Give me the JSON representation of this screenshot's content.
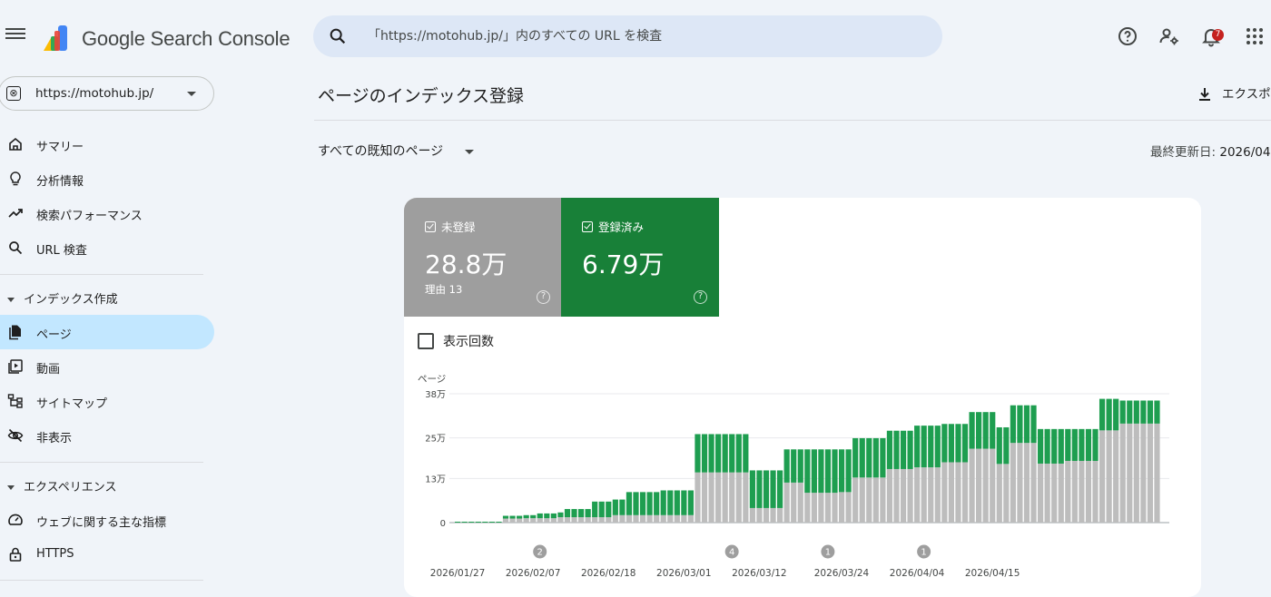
{
  "header": {
    "brand": "Google Search Console",
    "search_placeholder": "「https://motohub.jp/」内のすべての URL を検査",
    "notification_count": "7",
    "icons": [
      "menu-icon",
      "search-icon",
      "help-icon",
      "account-settings-icon",
      "bell-icon",
      "apps-icon"
    ]
  },
  "sidebar": {
    "property": "https://motohub.jp/",
    "items": [
      {
        "label": "サマリー",
        "icon": "home-icon"
      },
      {
        "label": "分析情報",
        "icon": "lightbulb-icon"
      },
      {
        "label": "検索パフォーマンス",
        "icon": "trending-icon"
      },
      {
        "label": "URL 検査",
        "icon": "search-icon"
      }
    ],
    "section_index": "インデックス作成",
    "index_items": [
      {
        "label": "ページ",
        "icon": "pages-icon",
        "active": true
      },
      {
        "label": "動画",
        "icon": "video-icon"
      },
      {
        "label": "サイトマップ",
        "icon": "sitemap-icon"
      },
      {
        "label": "非表示",
        "icon": "hidden-icon"
      }
    ],
    "section_experience": "エクスペリエンス",
    "experience_items": [
      {
        "label": "ウェブに関する主な指標",
        "icon": "gauge-icon"
      },
      {
        "label": "HTTPS",
        "icon": "lock-icon"
      }
    ]
  },
  "main": {
    "title": "ページのインデックス登録",
    "export_label": "エクスポ",
    "filter_label": "すべての既知のページ",
    "updated_label": "最終更新日:",
    "updated_value": "2026/04"
  },
  "tiles": {
    "not_indexed": {
      "label": "未登録",
      "value": "28.8万",
      "sub": "理由 13",
      "color": "#9e9e9e"
    },
    "indexed": {
      "label": "登録済み",
      "value": "6.79万",
      "color": "#188038"
    }
  },
  "impressions_label": "表示回数",
  "chart_data": {
    "type": "bar",
    "stacked": true,
    "ylabel": "ページ",
    "ylim": [
      0,
      380000
    ],
    "y_ticks": [
      {
        "v": 0,
        "label": "0"
      },
      {
        "v": 130000,
        "label": "13万"
      },
      {
        "v": 250000,
        "label": "25万"
      },
      {
        "v": 380000,
        "label": "38万"
      }
    ],
    "x_tick_labels": [
      {
        "i": 0,
        "label": "2026/01/27"
      },
      {
        "i": 11,
        "label": "2026/02/07"
      },
      {
        "i": 22,
        "label": "2026/02/18"
      },
      {
        "i": 33,
        "label": "2026/03/01"
      },
      {
        "i": 44,
        "label": "2026/03/12"
      },
      {
        "i": 56,
        "label": "2026/03/24"
      },
      {
        "i": 67,
        "label": "2026/04/04"
      },
      {
        "i": 78,
        "label": "2026/04/15"
      }
    ],
    "annotations": [
      {
        "i": 12,
        "label": "2"
      },
      {
        "i": 40,
        "label": "4"
      },
      {
        "i": 54,
        "label": "1"
      },
      {
        "i": 68,
        "label": "1"
      }
    ],
    "grid": true,
    "series": [
      {
        "name": "未登録",
        "color": "#bdbdbd",
        "values": [
          0,
          0,
          0,
          0,
          0,
          0,
          0,
          12000,
          12000,
          12000,
          13000,
          13000,
          13000,
          13000,
          13000,
          16000,
          16000,
          16000,
          16000,
          16000,
          16000,
          16000,
          16000,
          22000,
          22000,
          22000,
          22000,
          22000,
          22000,
          22000,
          22000,
          22000,
          22000,
          22000,
          22000,
          148000,
          148000,
          148000,
          148000,
          148000,
          148000,
          148000,
          148000,
          43000,
          43000,
          43000,
          43000,
          43000,
          118000,
          118000,
          118000,
          88000,
          88000,
          88000,
          88000,
          88000,
          90000,
          90000,
          133000,
          133000,
          133000,
          133000,
          133000,
          158000,
          158000,
          158000,
          158000,
          163000,
          163000,
          163000,
          163000,
          178000,
          178000,
          178000,
          178000,
          218000,
          218000,
          218000,
          218000,
          173000,
          173000,
          235000,
          235000,
          235000,
          235000,
          174000,
          174000,
          174000,
          174000,
          182000,
          182000,
          182000,
          182000,
          182000,
          272000,
          272000,
          272000,
          292000,
          292000,
          292000,
          292000,
          292000,
          292000
        ]
      },
      {
        "name": "登録済み",
        "color": "#1e9e50",
        "values": [
          1000,
          1000,
          1000,
          1000,
          1000,
          1000,
          1000,
          8000,
          8000,
          8000,
          9000,
          9000,
          14000,
          14000,
          14000,
          14000,
          24000,
          24000,
          24000,
          24000,
          46000,
          46000,
          46000,
          46000,
          46000,
          68000,
          68000,
          68000,
          68000,
          68000,
          73000,
          73000,
          73000,
          73000,
          73000,
          113000,
          113000,
          113000,
          113000,
          113000,
          113000,
          113000,
          113000,
          111000,
          111000,
          111000,
          111000,
          111000,
          98000,
          98000,
          98000,
          128000,
          128000,
          128000,
          128000,
          128000,
          126000,
          126000,
          116000,
          116000,
          116000,
          116000,
          116000,
          113000,
          113000,
          113000,
          113000,
          123000,
          123000,
          123000,
          123000,
          113000,
          113000,
          113000,
          113000,
          108000,
          108000,
          108000,
          108000,
          108000,
          108000,
          111000,
          111000,
          111000,
          111000,
          102000,
          102000,
          102000,
          102000,
          94000,
          94000,
          94000,
          94000,
          94000,
          93000,
          93000,
          93000,
          68000,
          68000,
          68000,
          68000,
          68000,
          68000
        ]
      }
    ]
  }
}
